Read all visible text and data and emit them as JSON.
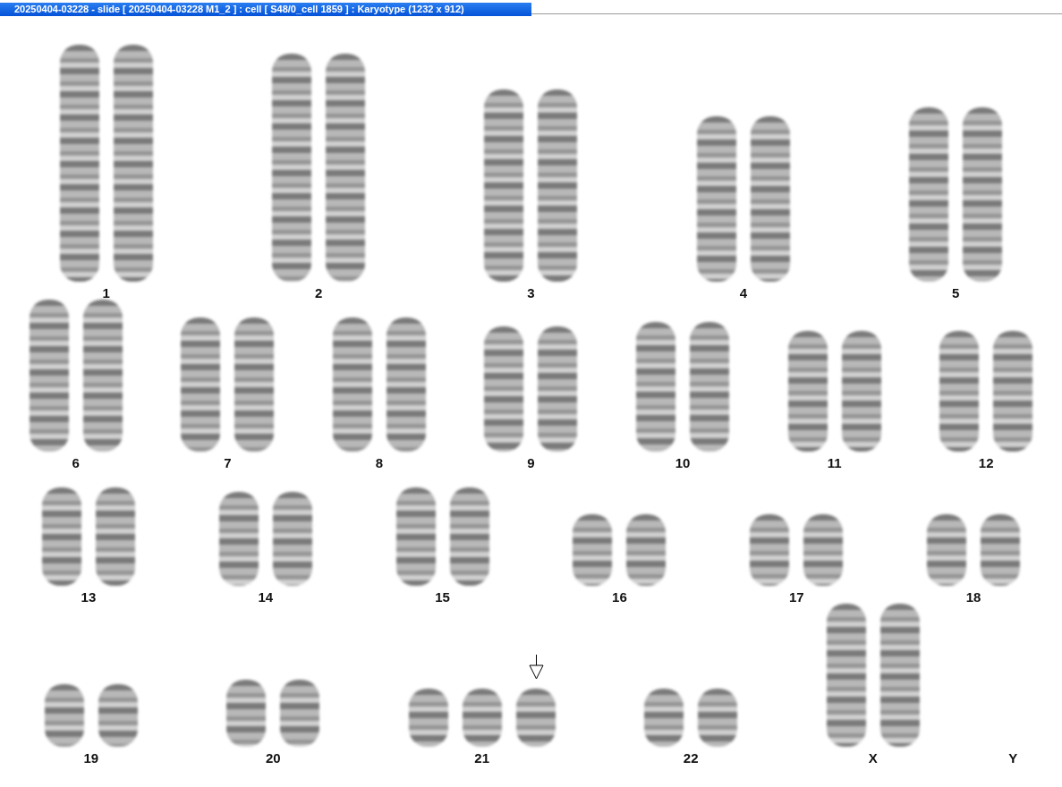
{
  "window": {
    "title": "20250404-03228 - slide [ 20250404-03228 M1_2 ] : cell [ S48/0_cell 1859 ] : Karyotype  (1232 x 912)"
  },
  "rows": [
    {
      "groups": [
        {
          "label": "1",
          "chromosomes": [
            {
              "kind": "plain"
            },
            {
              "kind": "plain"
            }
          ]
        },
        {
          "label": "2",
          "chromosomes": [
            {
              "kind": "plain"
            },
            {
              "kind": "plain"
            }
          ]
        },
        {
          "label": "3",
          "chromosomes": [
            {
              "kind": "plain"
            },
            {
              "kind": "plain"
            }
          ]
        },
        {
          "label": "4",
          "chromosomes": [
            {
              "kind": "plain"
            },
            {
              "kind": "plain"
            }
          ]
        },
        {
          "label": "5",
          "chromosomes": [
            {
              "kind": "plain"
            },
            {
              "kind": "plain"
            }
          ]
        }
      ]
    },
    {
      "groups": [
        {
          "label": "6",
          "chromosomes": [
            {
              "kind": "plain"
            },
            {
              "kind": "plain"
            }
          ]
        },
        {
          "label": "7",
          "chromosomes": [
            {
              "kind": "plain"
            },
            {
              "kind": "plain"
            }
          ]
        },
        {
          "label": "8",
          "chromosomes": [
            {
              "kind": "plain"
            },
            {
              "kind": "plain"
            }
          ]
        },
        {
          "label": "9",
          "chromosomes": [
            {
              "kind": "plain"
            },
            {
              "kind": "plain"
            }
          ]
        },
        {
          "label": "10",
          "chromosomes": [
            {
              "kind": "plain"
            },
            {
              "kind": "plain"
            }
          ]
        },
        {
          "label": "11",
          "chromosomes": [
            {
              "kind": "plain"
            },
            {
              "kind": "plain"
            }
          ]
        },
        {
          "label": "12",
          "chromosomes": [
            {
              "kind": "plain"
            },
            {
              "kind": "plain"
            }
          ]
        }
      ]
    },
    {
      "groups": [
        {
          "label": "13",
          "chromosomes": [
            {
              "kind": "plain"
            },
            {
              "kind": "plain"
            }
          ]
        },
        {
          "label": "14",
          "chromosomes": [
            {
              "kind": "plain"
            },
            {
              "kind": "plain"
            }
          ]
        },
        {
          "label": "15",
          "chromosomes": [
            {
              "kind": "plain"
            },
            {
              "kind": "plain"
            }
          ]
        },
        {
          "label": "16",
          "chromosomes": [
            {
              "kind": "plain"
            },
            {
              "kind": "plain"
            }
          ]
        },
        {
          "label": "17",
          "chromosomes": [
            {
              "kind": "plain"
            },
            {
              "kind": "plain"
            }
          ]
        },
        {
          "label": "18",
          "chromosomes": [
            {
              "kind": "plain"
            },
            {
              "kind": "plain"
            }
          ]
        }
      ]
    },
    {
      "groups": [
        {
          "label": "19",
          "chromosomes": [
            {
              "kind": "plain"
            },
            {
              "kind": "plain"
            }
          ]
        },
        {
          "label": "20",
          "chromosomes": [
            {
              "kind": "plain"
            },
            {
              "kind": "plain"
            }
          ]
        },
        {
          "label": "21",
          "chromosomes": [
            {
              "kind": "plain"
            },
            {
              "kind": "plain"
            },
            {
              "kind": "flagged"
            }
          ]
        },
        {
          "label": "22",
          "chromosomes": [
            {
              "kind": "plain"
            },
            {
              "kind": "plain"
            }
          ]
        },
        {
          "label": "X",
          "chromosomes": [
            {
              "kind": "plain"
            },
            {
              "kind": "plain"
            }
          ]
        },
        {
          "label": "Y"
        }
      ]
    }
  ]
}
